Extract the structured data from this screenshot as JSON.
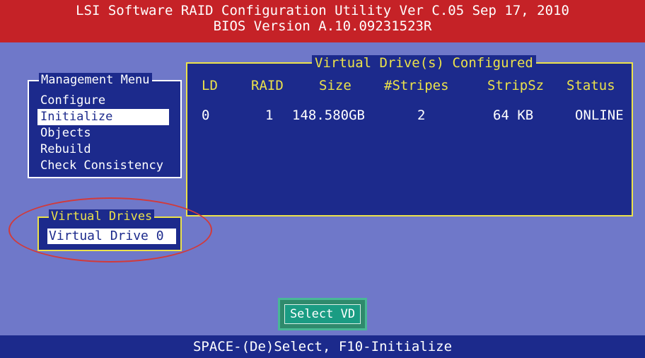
{
  "title": {
    "line1": "LSI Software RAID Configuration Utility Ver C.05 Sep 17, 2010",
    "line2": "BIOS Version   A.10.09231523R"
  },
  "management_menu": {
    "title": "Management Menu",
    "items": [
      "Configure",
      "Initialize",
      "Objects",
      "Rebuild",
      "Check Consistency"
    ],
    "selected": "Initialize"
  },
  "vd_configured": {
    "title": "Virtual Drive(s) Configured",
    "columns": [
      "LD",
      "RAID",
      "Size",
      "#Stripes",
      "StripSz",
      "Status"
    ],
    "rows": [
      [
        "0",
        "1",
        "148.580GB",
        "2",
        "64 KB",
        "ONLINE"
      ]
    ]
  },
  "virtual_drives": {
    "title": "Virtual Drives",
    "items": [
      "Virtual Drive 0"
    ]
  },
  "select_button": {
    "label": "Select VD"
  },
  "status_bar": {
    "text": "SPACE-(De)Select,  F10-Initialize"
  },
  "colors": {
    "background": "#6f78c9",
    "panel": "#1c2a8c",
    "title_bar": "#c52227",
    "highlight": "#ece24a",
    "button": "#1a9c83",
    "annotation": "#d23a3a"
  }
}
